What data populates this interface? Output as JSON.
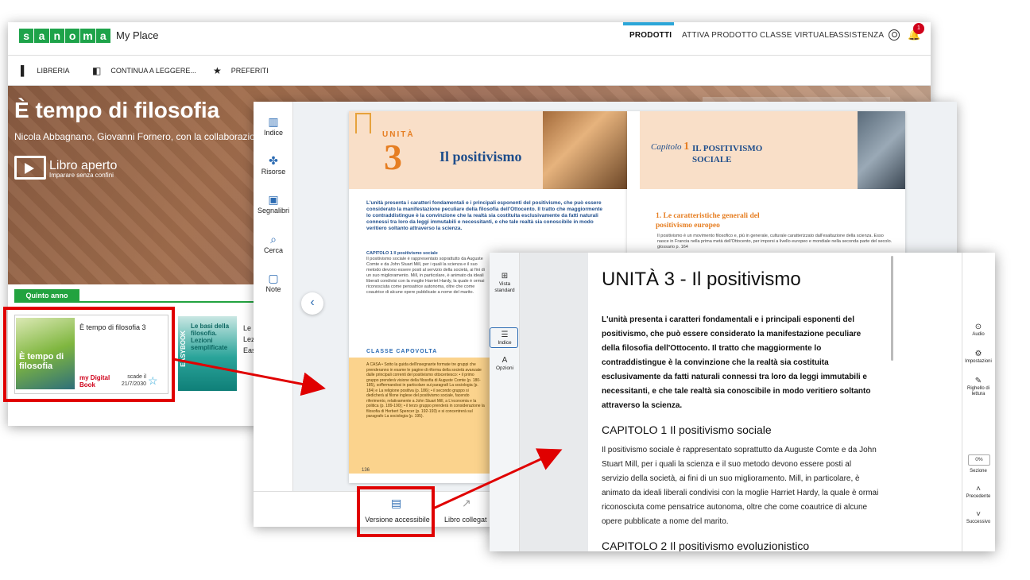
{
  "myplace": {
    "logo": [
      "s",
      "a",
      "n",
      "o",
      "m",
      "a"
    ],
    "logo_sub": "My Place",
    "topnav": [
      "PRODOTTI",
      "ATTIVA PRODOTTO",
      "CLASSE VIRTUALE",
      "ASSISTENZA"
    ],
    "notification_count": "1",
    "subnav": [
      "LIBRERIA",
      "CONTINUA A LEGGERE...",
      "PREFERITI"
    ],
    "hero_title": "È tempo di filosofia",
    "hero_authors": "Nicola Abbagnano, Giovanni Fornero, con la collaborazione",
    "brand_title": "Libro aperto",
    "brand_sub": "Imparare senza confini",
    "tab_label": "Quinto anno",
    "card1": {
      "cover_title": "È tempo di filosofia",
      "title": "È tempo di filosofia 3",
      "brand": "my Digital Book",
      "expiry_label": "scade il",
      "expiry_date": "21/7/2030"
    },
    "card2": {
      "cover_title": "Le basi della filosofia. Lezioni semplificate",
      "cover_band": "EASYBOOK",
      "title_lines": [
        "Le b",
        "Lez",
        "Eas"
      ]
    }
  },
  "reader": {
    "sidebar": [
      "Indice",
      "Risorse",
      "Segnalibri",
      "Cerca",
      "Note"
    ],
    "bottom": [
      "Versione accessibile",
      "Libro collegat"
    ],
    "left_page": {
      "unit_label": "UNITÀ",
      "unit_number": "3",
      "title": "Il positivismo",
      "intro": "L'unità presenta i caratteri fondamentali e i principali esponenti del positivismo, che può essere considerato la manifestazione peculiare della filosofia dell'Ottocento. Il tratto che maggiormente lo contraddistingue è la convinzione che la realtà sia costituita esclusivamente da fatti naturali connessi tra loro da leggi immutabili e necessitanti, e che tale realtà sia conoscibile in modo veritiero soltanto attraverso la scienza.",
      "chapter_head": "CAPITOLO 1 Il positivismo sociale",
      "chapter_text": "Il positivismo sociale è rappresentato soprattutto da Auguste Comte e da John Stuart Mill, per i quali la scienza e il suo metodo devono essere posti al servizio della società, ai fini di un suo miglioramento. Mill, in particolare, è animato da ideali liberali condivisi con la moglie Harriet Hardy, la quale è ormai riconosciuta come pensatrice autonoma, oltre che come coautrice di alcune opere pubblicate a nome del marito.",
      "box_head": "CLASSE CAPOVOLTA",
      "box_text": "A CASA • Sotto la guida dell'insegnante formate tre gruppi che prenderanno in esame le pagine di riforma della società avanzate dalle principali correnti del positivismo ottocentesco: • il primo gruppo prenderà visione della filosofia di Auguste Comte (p. 180-185), soffermandosi in particolare sui paragrafi La sociologia (p. 184) e La religione positiva (p. 186); • il secondo gruppo si dedicherà al filone inglese del positivismo sociale, facendo riferimento, relativamente a John Stuart Mill, a L'economia e la politica (p. 189-190); • il terzo gruppo prenderà in considerazione la filosofia di Herbert Spencer (p. 192-193) e si concentrerà sul paragrafo La sociologia (p. 195).",
      "page_number": "136"
    },
    "right_page": {
      "chapter_label": "Capitolo",
      "chapter_number": "1",
      "title": "IL POSITIVISMO SOCIALE",
      "heading": "1. Le caratteristiche generali del positivismo europeo",
      "text": "Il positivismo è un movimento filosofico e, più in generale, culturale caratterizzato dall'esaltazione della scienza. Esso nasce in Francia nella prima metà dell'Ottocento, per imporsi a livello europeo e mondiale nella seconda parte del secolo. glossario p. 164"
    }
  },
  "accessible": {
    "left_tools": [
      "Vista standard",
      "Indice",
      "Opzioni"
    ],
    "right_tools": [
      "Audio",
      "Impostazioni",
      "Righello di lettura"
    ],
    "progress_value": "0%",
    "nav": [
      "Sezione",
      "Precedente",
      "Successivo"
    ],
    "title": "UNITÀ 3 - Il positivismo",
    "intro": "L'unità presenta i caratteri fondamentali e i principali esponenti del positivismo, che può essere considerato la manifestazione peculiare della filosofia dell'Ottocento. Il tratto che maggiormente lo contraddistingue è la convinzione che la realtà sia costituita esclusivamente da fatti naturali connessi tra loro da leggi immutabili e necessitanti, e che tale realtà sia conoscibile in modo veritiero soltanto attraverso la scienza.",
    "h2a": "CAPITOLO 1 Il positivismo sociale",
    "p1": "Il positivismo sociale è rappresentato soprattutto da Auguste Comte e da John Stuart Mill, per i quali la scienza e il suo metodo devono essere posti al servizio della società, ai fini di un suo miglioramento. Mill, in particolare, è animato da ideali liberali condivisi con la moglie Harriet Hardy, la quale è ormai riconosciuta come pensatrice autonoma, oltre che come coautrice di alcune opere pubblicate a nome del marito.",
    "h2b": "CAPITOLO 2 Il positivismo evoluzionistico"
  },
  "colors": {
    "brand_green": "#1ea34a",
    "accent_blue": "#2ba6d8",
    "highlight_red": "#e00000",
    "orange": "#e67e22"
  }
}
